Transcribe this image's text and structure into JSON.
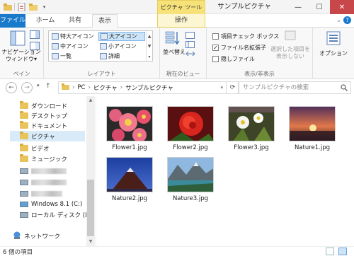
{
  "window": {
    "title": "サンプルピクチャ",
    "tool_tab_header": "ピクチャ ツール",
    "minimize": "—",
    "maximize": "☐",
    "close": "✕"
  },
  "tabs": [
    "ファイル",
    "ホーム",
    "共有",
    "表示",
    "操作"
  ],
  "ribbon": {
    "pane_group": {
      "nav_pane": "ナビゲーション\nウィンドウ▾",
      "label": "ペイン"
    },
    "layout_group": {
      "items": [
        "特大アイコン",
        "大アイコン",
        "中アイコン",
        "小アイコン",
        "一覧",
        "詳細"
      ],
      "selected": "大アイコン",
      "label": "レイアウト"
    },
    "current_view_group": {
      "sort": "並べ替え",
      "label": "現在のビュー"
    },
    "show_hide_group": {
      "item_checkbox": "項目チェック ボックス",
      "file_ext": "ファイル名拡張子",
      "hidden_files": "隠しファイル",
      "hide_selected": "選択した項目を\n表示しない",
      "label": "表示/非表示"
    },
    "options": "オプション"
  },
  "address": {
    "path": [
      "PC",
      "ピクチャ",
      "サンプルピクチャ"
    ],
    "search_placeholder": "サンプルピクチャの検索"
  },
  "nav": {
    "items": [
      {
        "label": "ダウンロード"
      },
      {
        "label": "デスクトップ"
      },
      {
        "label": "ドキュメント"
      },
      {
        "label": "ピクチャ"
      },
      {
        "label": "ビデオ"
      },
      {
        "label": "ミュージック"
      },
      {
        "label": "Windows 8.1 (C:)"
      },
      {
        "label": "ローカル ディスク (D:)"
      },
      {
        "label": "ネットワーク"
      }
    ]
  },
  "files": [
    {
      "name": "Flower1.jpg"
    },
    {
      "name": "Flower2.jpg"
    },
    {
      "name": "Flower3.jpg"
    },
    {
      "name": "Nature1.jpg"
    },
    {
      "name": "Nature2.jpg"
    },
    {
      "name": "Nature3.jpg"
    }
  ],
  "status": {
    "count": "6 個の項目"
  },
  "colors": {
    "file_tab": "#1979ca",
    "tool_tab": "#f7e27a",
    "selection": "#d9ebf9",
    "close_button": "#c7474a"
  }
}
